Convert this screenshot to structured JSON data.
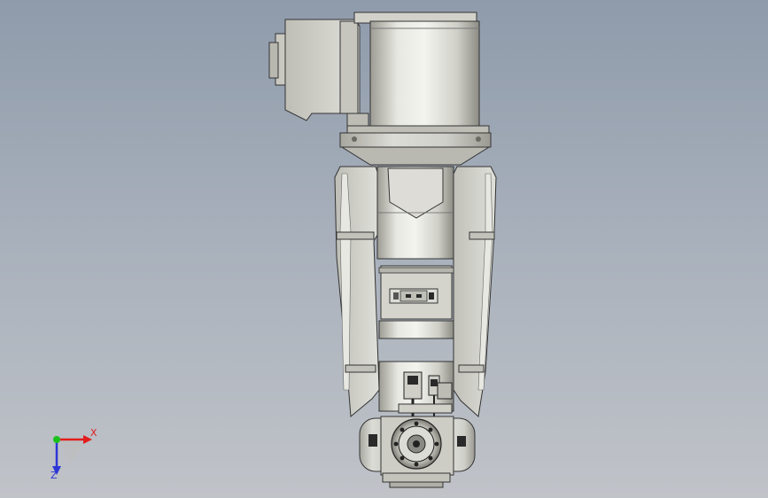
{
  "viewport": {
    "background_top": "#8f9bab",
    "background_bottom": "#c0c3c8"
  },
  "triad": {
    "x_label": "X",
    "z_label": "Z",
    "x_color": "#e21d1d",
    "y_color": "#19c219",
    "z_color": "#2e36d6"
  },
  "model": {
    "description_icon": "robot-arm-model",
    "metal_color": "#d6d6d0",
    "dark_color": "#2a2a2a"
  }
}
